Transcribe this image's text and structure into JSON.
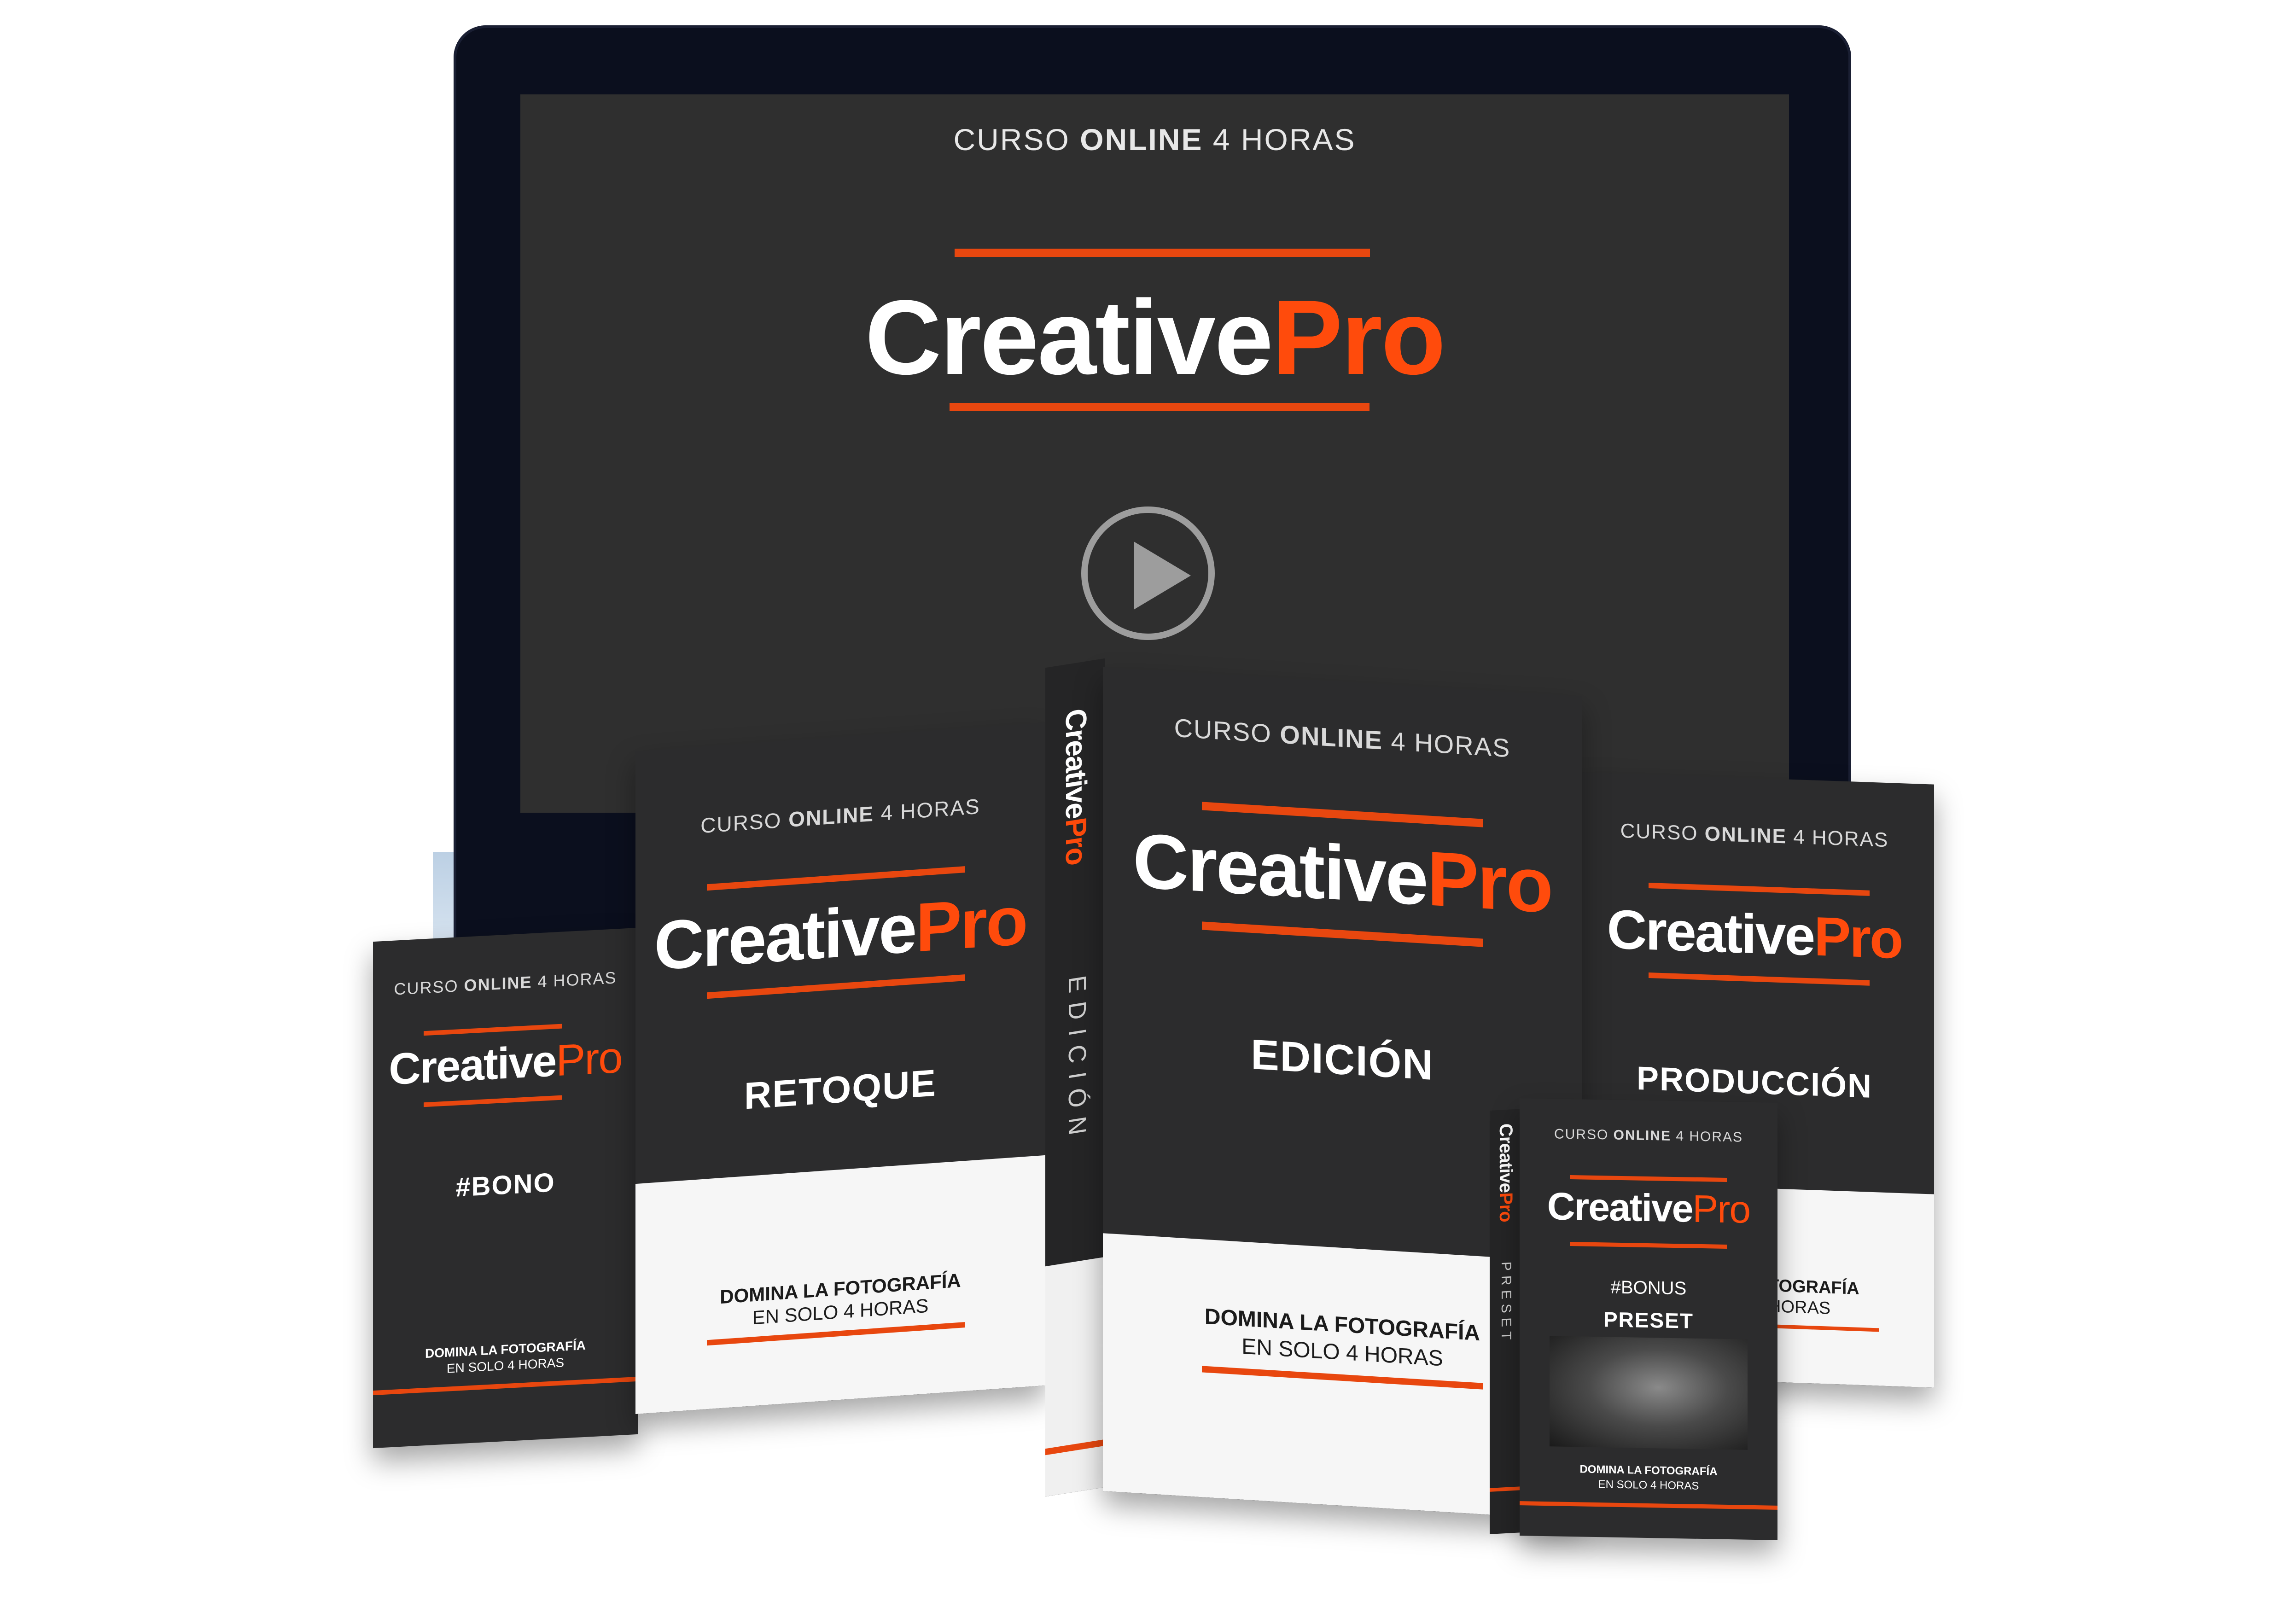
{
  "brand": {
    "word1": "Creative",
    "word2": "Pro",
    "accent_color": "#ff4b0c",
    "bg_color": "#2c2c2d"
  },
  "screen": {
    "subtitle_pre": "CURSO ",
    "subtitle_bold": "ONLINE",
    "subtitle_post": " 4 HORAS",
    "play_icon": "play-icon"
  },
  "boxes": {
    "bono": {
      "cur_pre": "CURSO ",
      "cur_bold": "ONLINE",
      "cur_post": " 4 HORAS",
      "title": "#BONO",
      "line1": "DOMINA LA FOTOGRAFÍA",
      "line2": "EN SOLO 4 HORAS"
    },
    "retoque": {
      "cur_pre": "CURSO ",
      "cur_bold": "ONLINE",
      "cur_post": " 4 HORAS",
      "title": "RETOQUE",
      "line1": "DOMINA LA FOTOGRAFÍA",
      "line2": "EN SOLO 4 HORAS"
    },
    "edicion": {
      "cur_pre": "CURSO ",
      "cur_bold": "ONLINE",
      "cur_post": " 4 HORAS",
      "title": "EDICIÓN",
      "line1": "DOMINA LA FOTOGRAFÍA",
      "line2": "EN SOLO 4 HORAS",
      "spine_label": "EDICIÓN"
    },
    "produccion": {
      "cur_pre": "CURSO ",
      "cur_bold": "ONLINE",
      "cur_post": " 4 HORAS",
      "title": "PRODUCCIÓN",
      "line1": "TOGRAFÍA",
      "line2": "HORAS"
    },
    "preset": {
      "cur_pre": "CURSO ",
      "cur_bold": "ONLINE",
      "cur_post": " 4 HORAS",
      "tag": "#BONUS",
      "title": "PRESET",
      "line1": "DOMINA LA FOTOGRAFÍA",
      "line2": "EN SOLO 4 HORAS",
      "spine_label": "PRESET"
    }
  }
}
